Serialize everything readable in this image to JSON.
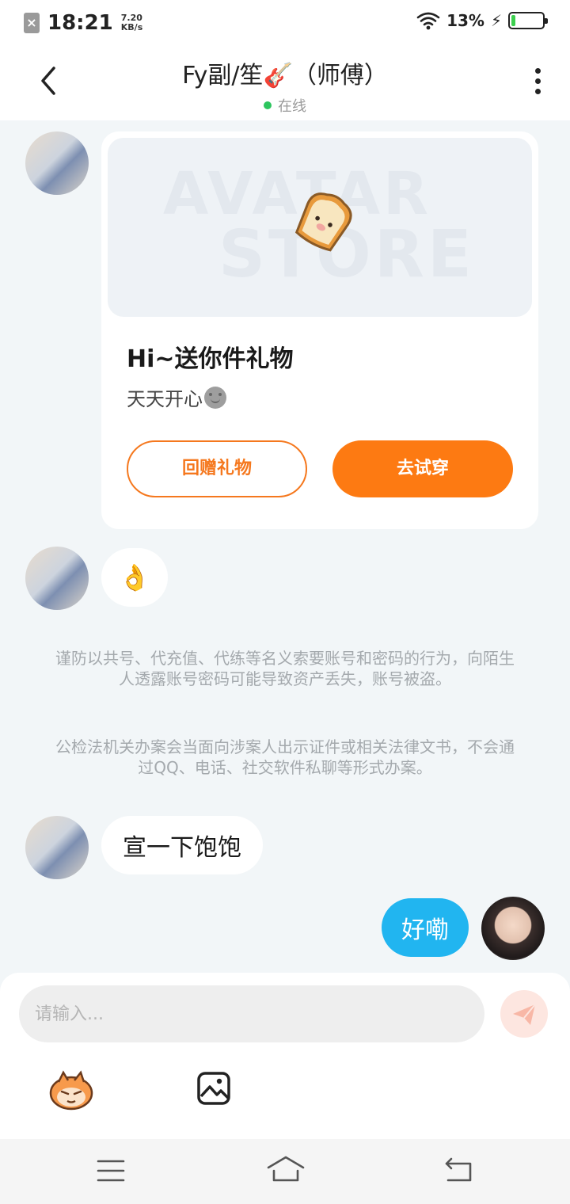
{
  "status_bar": {
    "time": "18:21",
    "net_speed_value": "7.20",
    "net_speed_unit": "KB/s",
    "battery_percent": "13%",
    "battery_level": 0.13
  },
  "header": {
    "title": "Fy副/笙🎸（师傅）",
    "status": "在线"
  },
  "messages": [
    {
      "type": "gift_card",
      "sender": "other",
      "banner_text_1": "AVATAR",
      "banner_text_2": "STORE",
      "title": "Hi~送你件礼物",
      "subtitle": "天天开心",
      "button_return": "回赠礼物",
      "button_try": "去试穿"
    },
    {
      "type": "emoji",
      "sender": "other",
      "text": "👌"
    },
    {
      "type": "notice",
      "paragraph_1": "谨防以共号、代充值、代练等名义索要账号和密码的行为，向陌生人透露账号密码可能导致资产丢失，账号被盗。",
      "paragraph_2": "公检法机关办案会当面向涉案人出示证件或相关法律文书，不会通过QQ、电话、社交软件私聊等形式办案。"
    },
    {
      "type": "text",
      "sender": "other",
      "text": "宣一下饱饱"
    },
    {
      "type": "text",
      "sender": "me",
      "text": "好嘞"
    }
  ],
  "input": {
    "placeholder": "请输入..."
  },
  "colors": {
    "accent_orange": "#fd7a12",
    "my_bubble": "#21b5f0",
    "online_dot": "#2dc55e"
  }
}
